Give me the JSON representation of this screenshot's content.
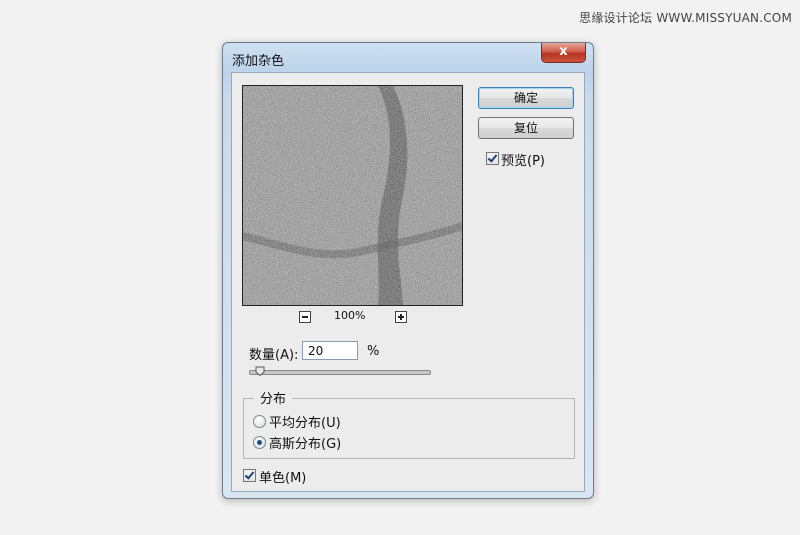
{
  "watermark": "思缘设计论坛  WWW.MISSYUAN.COM",
  "dialog": {
    "title": "添加杂色",
    "close_label": "x",
    "ok_label": "确定",
    "reset_label": "复位",
    "preview_label": "预览(P)",
    "preview_checked": true,
    "zoom_level": "100%",
    "amount_label": "数量(A):",
    "amount_value": "20",
    "amount_unit": "%",
    "amount_slider_fraction": 0.05,
    "distribution": {
      "legend": "分布",
      "uniform_label": "平均分布(U)",
      "gaussian_label": "高斯分布(G)",
      "selected": "gaussian"
    },
    "monochromatic_label": "单色(M)",
    "monochromatic_checked": true
  },
  "icons": {
    "zoom_out": "minus-square-icon",
    "zoom_in": "plus-square-icon",
    "close": "close-icon"
  }
}
